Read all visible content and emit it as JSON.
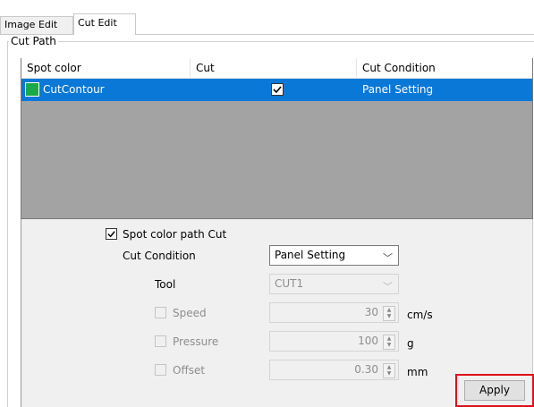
{
  "tabs": [
    {
      "label": "Image Edit",
      "active": false
    },
    {
      "label": "Cut Edit",
      "active": true
    }
  ],
  "group_title": "Cut Path",
  "list": {
    "columns": [
      "Spot color",
      "Cut",
      "Cut Condition"
    ],
    "rows": [
      {
        "spot_color": "CutContour",
        "swatch_color": "#19a948",
        "cut": true,
        "cut_condition": "Panel Setting",
        "selected": true
      }
    ]
  },
  "options": {
    "spot_color_path_cut": {
      "label": "Spot color path Cut",
      "checked": true
    },
    "cut_condition": {
      "label": "Cut Condition",
      "value": "Panel Setting"
    },
    "tool": {
      "label": "Tool",
      "value": "CUT1",
      "enabled": false
    },
    "speed": {
      "label": "Speed",
      "value": "30",
      "unit": "cm/s",
      "checked": false,
      "enabled": false
    },
    "pressure": {
      "label": "Pressure",
      "value": "100",
      "unit": "g",
      "checked": false,
      "enabled": false
    },
    "offset": {
      "label": "Offset",
      "value": "0.30",
      "unit": "mm",
      "checked": false,
      "enabled": false
    }
  },
  "apply_label": "Apply",
  "colors": {
    "selection": "#0a78d7",
    "highlight": "#e0101a",
    "swatch": "#19a948"
  }
}
